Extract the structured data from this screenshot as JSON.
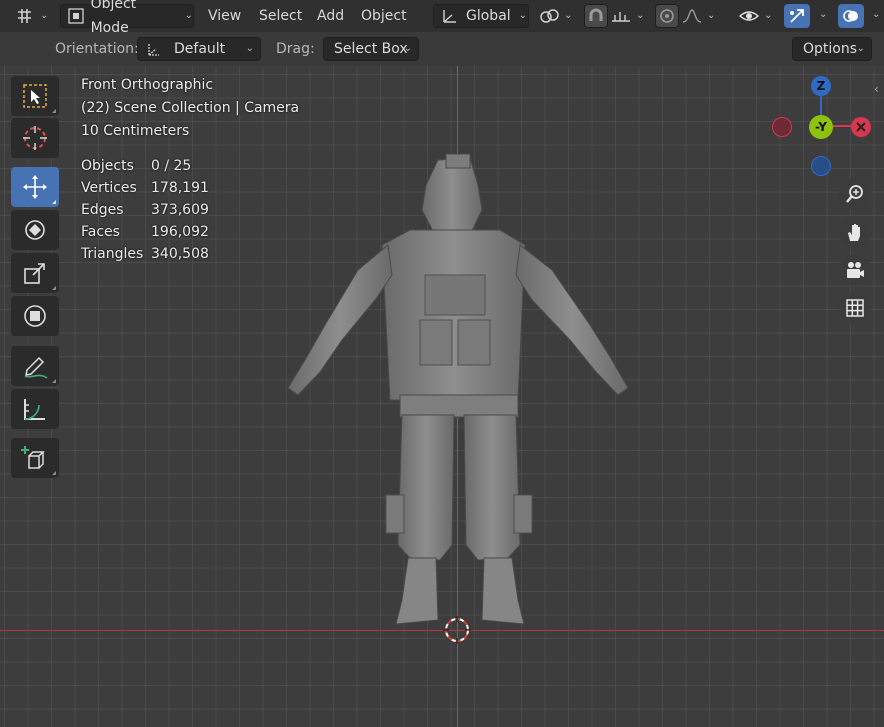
{
  "header": {
    "mode_label": "Object Mode",
    "menus": [
      "View",
      "Select",
      "Add",
      "Object"
    ],
    "transform_orientation": "Global"
  },
  "tool_settings": {
    "orientation_label": "Orientation:",
    "orientation_value": "Default",
    "drag_label": "Drag:",
    "drag_value": "Select Box",
    "options_label": "Options"
  },
  "overlay": {
    "view_name": "Front Orthographic",
    "collection": "(22) Scene Collection | Camera",
    "scale": "10 Centimeters",
    "stats": [
      {
        "label": "Objects",
        "value": "0 / 25"
      },
      {
        "label": "Vertices",
        "value": "178,191"
      },
      {
        "label": "Edges",
        "value": "373,609"
      },
      {
        "label": "Faces",
        "value": "196,092"
      },
      {
        "label": "Triangles",
        "value": "340,508"
      }
    ]
  },
  "gizmo": {
    "z_label": "Z",
    "y_label": "-Y"
  },
  "colors": {
    "accent": "#4772b3",
    "x_axis": "#b2393d",
    "z_axis": "#3f6fc0",
    "gizmo_z": "#2e6bc4",
    "gizmo_y": "#8bc30f",
    "gizmo_x": "#d5384f"
  },
  "left_tools": [
    "select-box-tool",
    "cursor-tool",
    "move-tool",
    "rotate-tool",
    "scale-tool",
    "transform-tool",
    "annotate-tool",
    "measure-tool",
    "add-cube-tool"
  ],
  "nav_buttons": [
    "zoom-icon",
    "pan-hand-icon",
    "camera-view-icon",
    "grid-view-icon"
  ]
}
